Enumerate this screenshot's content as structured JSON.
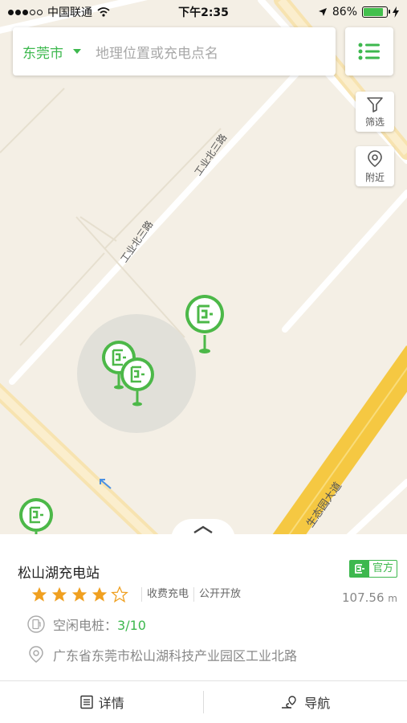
{
  "status_bar": {
    "carrier": "中国联通",
    "time": "下午2:35",
    "battery_percent": "86%",
    "battery_level": 0.86
  },
  "search": {
    "city": "东莞市",
    "placeholder": "地理位置或充电点名"
  },
  "side_buttons": {
    "filter_label": "筛选",
    "nearby_label": "附近"
  },
  "map": {
    "road_labels": [
      "工业北三路",
      "工业北三路",
      "生态园大道"
    ],
    "colors": {
      "land": "#f4efe5",
      "road": "#ffffff",
      "main_road": "#f5c842",
      "marker": "#4cb848"
    }
  },
  "station": {
    "name": "松山湖充电站",
    "official_label": "官方",
    "rating": 4,
    "rating_max": 5,
    "tags": [
      "收费充电",
      "公开开放"
    ],
    "distance_value": "107.56",
    "distance_unit": "m",
    "idle_label": "空闲电桩：",
    "idle_value": "3/10",
    "address": "广东省东莞市松山湖科技产业园区工业北路"
  },
  "bottom_tabs": {
    "details": "详情",
    "navigate": "导航"
  },
  "colors": {
    "accent": "#3db84e",
    "star": "#f0a020"
  }
}
